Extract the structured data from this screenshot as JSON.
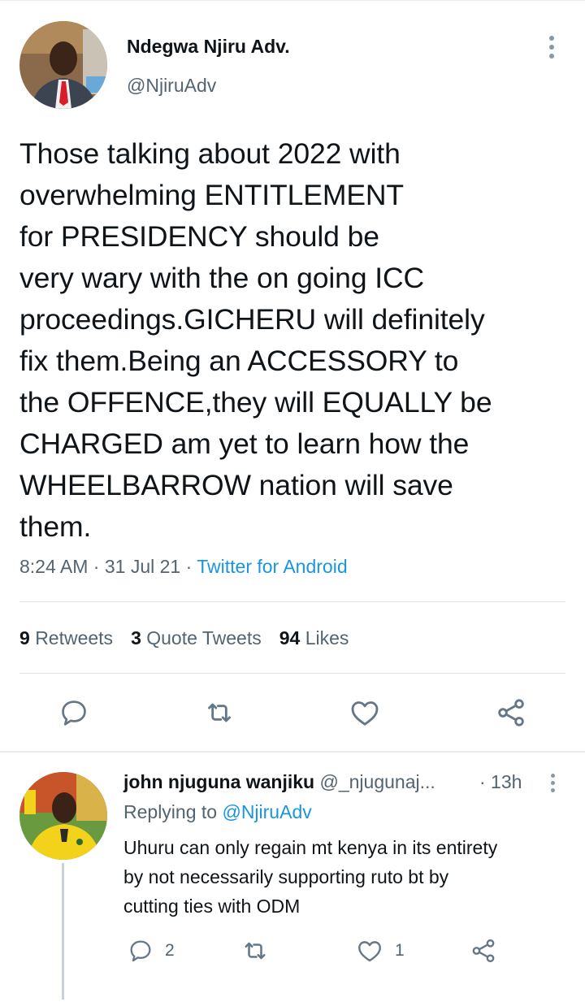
{
  "tweet": {
    "author_name": "Ndegwa Njiru Adv.",
    "author_handle": "@NjiruAdv",
    "text": "Those talking about 2022 with\noverwhelming ENTITLEMENT\nfor PRESIDENCY should be\nvery wary with the on going ICC\nproceedings.GICHERU  will definitely\nfix them.Being an ACCESSORY to\nthe OFFENCE,they will EQUALLY be\nCHARGED am yet to learn how the\nWHEELBARROW nation will save\nthem.",
    "time": "8:24 AM",
    "date": "31 Jul 21",
    "source": "Twitter for Android",
    "separator": "·",
    "stats": {
      "retweets_count": "9",
      "retweets_label": "Retweets",
      "quotes_count": "3",
      "quotes_label": "Quote Tweets",
      "likes_count": "94",
      "likes_label": "Likes"
    },
    "actions": [
      "reply-icon",
      "retweet-icon",
      "like-icon",
      "share-icon"
    ]
  },
  "reply": {
    "author_name": "john njuguna wanjiku",
    "author_handle": "@_njugunaj...",
    "time": "· 13h",
    "replying_prefix": "Replying to",
    "replying_to": "@NjiruAdv",
    "text": "Uhuru can only regain mt kenya in its entirety\nby not necessarily supporting ruto bt by\ncutting ties with ODM",
    "reply_count": "2",
    "like_count": "1"
  },
  "colors": {
    "text": "#0f1419",
    "secondary": "#536471",
    "link": "#1b95e0",
    "icon": "#657786"
  }
}
